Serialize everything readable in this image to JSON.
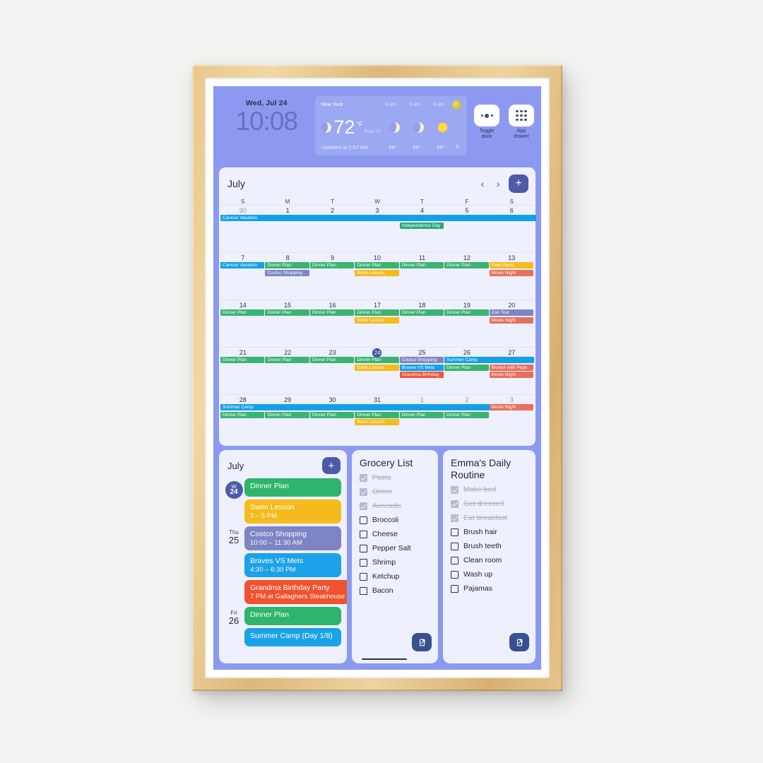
{
  "status_bar": {
    "date": "Wed, Jul 24",
    "time": "10:08",
    "dock_toggle_label_line1": "Toggle",
    "dock_toggle_label_line2": "dock",
    "app_drawer_label_line1": "App",
    "app_drawer_label_line2": "drawer"
  },
  "weather": {
    "city": "New York",
    "temp": "72",
    "unit": "°F",
    "feels": "Feels 72",
    "updated": "Updated at 2:57 AM",
    "hours": [
      "4 am",
      "5 am",
      "6 am"
    ],
    "hour_temps": [
      "68°",
      "66°",
      "68°"
    ],
    "hour_icons": [
      "moon",
      "moon",
      "sun"
    ],
    "refresh_icon": "↻"
  },
  "calendar": {
    "month": "July",
    "prev_label": "‹",
    "next_label": "›",
    "add_label": "+",
    "dow": [
      "S",
      "M",
      "T",
      "W",
      "T",
      "F",
      "S"
    ],
    "today": 24,
    "weeks": [
      {
        "days": [
          {
            "num": "30",
            "muted": true
          },
          {
            "num": "1",
            "muted": false
          },
          {
            "num": "2",
            "muted": false
          },
          {
            "num": "3",
            "muted": false
          },
          {
            "num": "4",
            "muted": false
          },
          {
            "num": "5",
            "muted": false
          },
          {
            "num": "6",
            "muted": false
          }
        ],
        "spans": [
          {
            "label": "Cancun Vacation",
            "start": 0,
            "len": 7,
            "row": 0,
            "color": "#14a0e8"
          },
          {
            "label": "Independence Day",
            "start": 4,
            "len": 1,
            "row": 1,
            "color": "#2aa87c"
          }
        ]
      },
      {
        "days": [
          {
            "num": "7",
            "muted": false
          },
          {
            "num": "8",
            "muted": false
          },
          {
            "num": "9",
            "muted": false
          },
          {
            "num": "10",
            "muted": false
          },
          {
            "num": "11",
            "muted": false
          },
          {
            "num": "12",
            "muted": false
          },
          {
            "num": "13",
            "muted": false
          }
        ],
        "spans": [
          {
            "label": "Cancun Vacation",
            "start": 0,
            "len": 1,
            "row": 0,
            "color": "#14a0e8"
          },
          {
            "label": "Dinner Plan",
            "start": 1,
            "len": 1,
            "row": 0,
            "color": "#3bb371"
          },
          {
            "label": "Costco Shopping",
            "start": 1,
            "len": 1,
            "row": 1,
            "color": "#7d85c4"
          },
          {
            "label": "Dinner Plan",
            "start": 2,
            "len": 1,
            "row": 0,
            "color": "#3bb371"
          },
          {
            "label": "Dinner Plan",
            "start": 3,
            "len": 1,
            "row": 0,
            "color": "#3bb371"
          },
          {
            "label": "Swim Lesson",
            "start": 3,
            "len": 1,
            "row": 1,
            "color": "#f5bb1d"
          },
          {
            "label": "Dinner Plan",
            "start": 4,
            "len": 1,
            "row": 0,
            "color": "#3bb371"
          },
          {
            "label": "Dinner Plan",
            "start": 5,
            "len": 1,
            "row": 0,
            "color": "#3bb371"
          },
          {
            "label": "Park Picnic",
            "start": 6,
            "len": 1,
            "row": 0,
            "color": "#f5bb1d"
          },
          {
            "label": "Movie Night",
            "start": 6,
            "len": 1,
            "row": 1,
            "color": "#e8705c"
          }
        ]
      },
      {
        "days": [
          {
            "num": "14",
            "muted": false
          },
          {
            "num": "15",
            "muted": false
          },
          {
            "num": "16",
            "muted": false
          },
          {
            "num": "17",
            "muted": false
          },
          {
            "num": "18",
            "muted": false
          },
          {
            "num": "19",
            "muted": false
          },
          {
            "num": "20",
            "muted": false
          }
        ],
        "spans": [
          {
            "label": "Dinner Plan",
            "start": 0,
            "len": 1,
            "row": 0,
            "color": "#3bb371"
          },
          {
            "label": "Dinner Plan",
            "start": 1,
            "len": 1,
            "row": 0,
            "color": "#3bb371"
          },
          {
            "label": "Dinner Plan",
            "start": 2,
            "len": 1,
            "row": 0,
            "color": "#3bb371"
          },
          {
            "label": "Dinner Plan",
            "start": 3,
            "len": 1,
            "row": 0,
            "color": "#3bb371"
          },
          {
            "label": "Swim Lesson",
            "start": 3,
            "len": 1,
            "row": 1,
            "color": "#f5bb1d"
          },
          {
            "label": "Dinner Plan",
            "start": 4,
            "len": 1,
            "row": 0,
            "color": "#3bb371"
          },
          {
            "label": "Dinner Plan",
            "start": 5,
            "len": 1,
            "row": 0,
            "color": "#3bb371"
          },
          {
            "label": "Zoo Tour",
            "start": 6,
            "len": 1,
            "row": 0,
            "color": "#7d85c4"
          },
          {
            "label": "Movie Night",
            "start": 6,
            "len": 1,
            "row": 1,
            "color": "#e8705c"
          }
        ]
      },
      {
        "days": [
          {
            "num": "21",
            "muted": false
          },
          {
            "num": "22",
            "muted": false
          },
          {
            "num": "23",
            "muted": false
          },
          {
            "num": "24",
            "muted": false
          },
          {
            "num": "25",
            "muted": false
          },
          {
            "num": "26",
            "muted": false
          },
          {
            "num": "27",
            "muted": false
          }
        ],
        "spans": [
          {
            "label": "Dinner Plan",
            "start": 0,
            "len": 1,
            "row": 0,
            "color": "#3bb371"
          },
          {
            "label": "Dinner Plan",
            "start": 1,
            "len": 1,
            "row": 0,
            "color": "#3bb371"
          },
          {
            "label": "Dinner Plan",
            "start": 2,
            "len": 1,
            "row": 0,
            "color": "#3bb371"
          },
          {
            "label": "Dinner Plan",
            "start": 3,
            "len": 1,
            "row": 0,
            "color": "#3bb371"
          },
          {
            "label": "Swim Lesson",
            "start": 3,
            "len": 1,
            "row": 1,
            "color": "#f5bb1d"
          },
          {
            "label": "Costco Shopping",
            "start": 4,
            "len": 1,
            "row": 0,
            "color": "#7d85c4"
          },
          {
            "label": "Braves VS Mets",
            "start": 4,
            "len": 1,
            "row": 1,
            "color": "#14a0e8"
          },
          {
            "label": "Grandma Birthday",
            "start": 4,
            "len": 1,
            "row": 2,
            "color": "#f0543a"
          },
          {
            "label": "Summer Camp",
            "start": 5,
            "len": 2,
            "row": 0,
            "color": "#14a0e8"
          },
          {
            "label": "Dinner Plan",
            "start": 5,
            "len": 1,
            "row": 1,
            "color": "#3bb371"
          },
          {
            "label": "Brunch with Pops",
            "start": 6,
            "len": 1,
            "row": 1,
            "color": "#e8705c"
          },
          {
            "label": "Movie Night",
            "start": 6,
            "len": 1,
            "row": 2,
            "color": "#e8705c"
          }
        ]
      },
      {
        "days": [
          {
            "num": "28",
            "muted": false
          },
          {
            "num": "29",
            "muted": false
          },
          {
            "num": "30",
            "muted": false
          },
          {
            "num": "31",
            "muted": false
          },
          {
            "num": "1",
            "muted": true
          },
          {
            "num": "2",
            "muted": true
          },
          {
            "num": "3",
            "muted": true
          }
        ],
        "spans": [
          {
            "label": "Summer Camp",
            "start": 0,
            "len": 6,
            "row": 0,
            "color": "#14a0e8"
          },
          {
            "label": "Movie Night",
            "start": 6,
            "len": 1,
            "row": 0,
            "color": "#e8705c"
          },
          {
            "label": "Dinner Plan",
            "start": 0,
            "len": 1,
            "row": 1,
            "color": "#3bb371"
          },
          {
            "label": "Dinner Plan",
            "start": 1,
            "len": 1,
            "row": 1,
            "color": "#3bb371"
          },
          {
            "label": "Dinner Plan",
            "start": 2,
            "len": 1,
            "row": 1,
            "color": "#3bb371"
          },
          {
            "label": "Dinner Plan",
            "start": 3,
            "len": 1,
            "row": 1,
            "color": "#3bb371"
          },
          {
            "label": "Swim Lesson",
            "start": 3,
            "len": 1,
            "row": 2,
            "color": "#f5bb1d"
          },
          {
            "label": "Dinner Plan",
            "start": 4,
            "len": 1,
            "row": 1,
            "color": "#3bb371"
          },
          {
            "label": "Dinner Plan",
            "start": 5,
            "len": 1,
            "row": 1,
            "color": "#3bb371"
          }
        ]
      }
    ]
  },
  "agenda": {
    "month": "July",
    "add_label": "+",
    "groups": [
      {
        "day_top": "W",
        "day_num": "24",
        "is_today": true,
        "events": [
          {
            "title": "Dinner Plan",
            "sub": "",
            "color": "#2fb56b"
          },
          {
            "title": "Swim Lesson",
            "sub": "3 – 5 PM",
            "color": "#f5bb1d"
          }
        ]
      },
      {
        "day_top": "Thu",
        "day_num": "25",
        "is_today": false,
        "events": [
          {
            "title": "Costco Shopping",
            "sub": "10:00 – 11:30 AM",
            "color": "#7d85c4"
          },
          {
            "title": "Braves VS Mets",
            "sub": "4:30 – 6:30 PM",
            "color": "#1ba2e8"
          },
          {
            "title": "Grandma Birthday Party",
            "sub": "7 PM at Gallaghers Steakhouse",
            "color": "#f0522e"
          }
        ]
      },
      {
        "day_top": "Fri",
        "day_num": "26",
        "is_today": false,
        "events": [
          {
            "title": "Dinner Plan",
            "sub": "",
            "color": "#2fb56b"
          },
          {
            "title": "Summer Camp (Day 1/8)",
            "sub": "",
            "color": "#1ba2e8"
          }
        ]
      }
    ]
  },
  "grocery": {
    "title": "Grocery List",
    "open_icon": "external-link",
    "items": [
      {
        "label": "Pasta",
        "checked": true
      },
      {
        "label": "Onion",
        "checked": true
      },
      {
        "label": "Avocado",
        "checked": true
      },
      {
        "label": "Broccoli",
        "checked": false
      },
      {
        "label": "Cheese",
        "checked": false
      },
      {
        "label": "Pepper Salt",
        "checked": false
      },
      {
        "label": "Shrimp",
        "checked": false
      },
      {
        "label": "Ketchup",
        "checked": false
      },
      {
        "label": "Bacon",
        "checked": false
      }
    ]
  },
  "routine": {
    "title": "Emma's Daily Routine",
    "open_icon": "external-link",
    "items": [
      {
        "label": "Make bed",
        "checked": true
      },
      {
        "label": "Get dressed",
        "checked": true
      },
      {
        "label": "Eat breakfast",
        "checked": true
      },
      {
        "label": "Brush hair",
        "checked": false
      },
      {
        "label": "Brush teeth",
        "checked": false
      },
      {
        "label": "Clean room",
        "checked": false
      },
      {
        "label": "Wash up",
        "checked": false
      },
      {
        "label": "Pajamas",
        "checked": false
      }
    ]
  }
}
